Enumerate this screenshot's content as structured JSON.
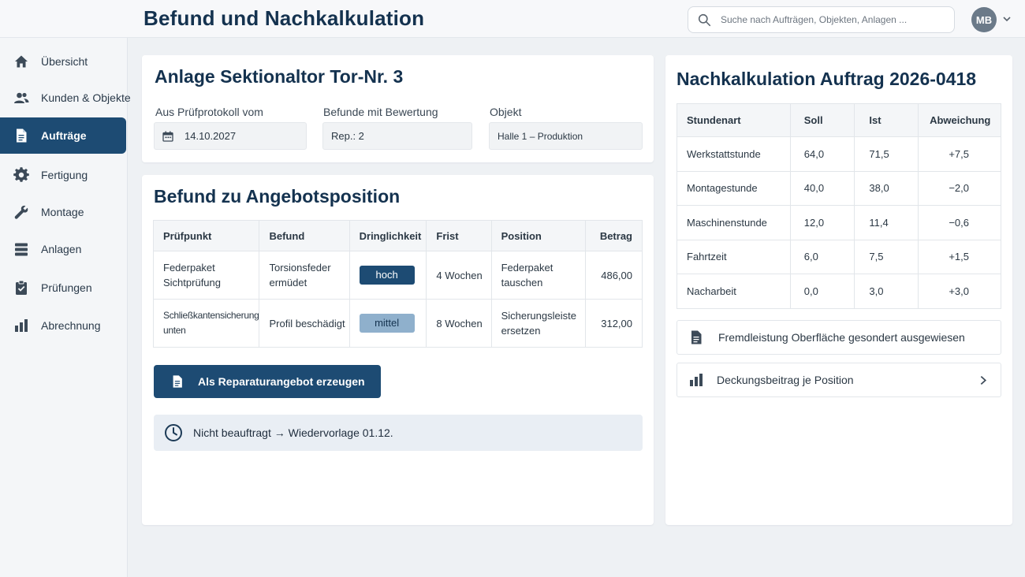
{
  "header": {
    "title": "Befund und Nachkalkulation",
    "search_placeholder": "Suche nach Aufträgen, Objekten, Anlagen ...",
    "avatar_initials": "MB"
  },
  "sidebar": {
    "items": [
      {
        "label": "Übersicht",
        "icon": "home-icon"
      },
      {
        "label": "Kunden & Objekte",
        "icon": "users-icon"
      },
      {
        "label": "Aufträge",
        "icon": "document-icon",
        "active": true
      },
      {
        "label": "Fertigung",
        "icon": "gear-icon"
      },
      {
        "label": "Montage",
        "icon": "wrench-icon"
      },
      {
        "label": "Anlagen",
        "icon": "layers-icon"
      },
      {
        "label": "Prüfungen",
        "icon": "clipboard-check-icon"
      },
      {
        "label": "Abrechnung",
        "icon": "bar-chart-icon"
      }
    ]
  },
  "anlage": {
    "title": "Anlage Sektionaltor Tor-Nr. 3",
    "fields": [
      {
        "label": "Aus Prüfprotokoll vom",
        "value": "14.10.2027"
      },
      {
        "label": "Befunde mit Bewertung",
        "value": "Rep.: 2"
      },
      {
        "label": "Objekt",
        "value": "Halle 1 – Produktion"
      }
    ]
  },
  "befund": {
    "title": "Befund zu Angebotsposition",
    "columns": [
      "Prüfpunkt",
      "Befund",
      "Dringlichkeit",
      "Frist",
      "Position",
      "Betrag"
    ],
    "rows": [
      {
        "pruefpunkt": "Federpaket Sichtprüfung",
        "befund": "Torsionsfeder ermüdet",
        "dringlichkeit": "hoch",
        "frist": "4 Wochen",
        "position": "Federpaket tauschen",
        "betrag": "486,00"
      },
      {
        "pruefpunkt": "Schließkantensicherung unten",
        "befund": "Profil beschädigt",
        "dringlichkeit": "mittel",
        "frist": "8 Wochen",
        "position": "Sicherungsleiste ersetzen",
        "betrag": "312,00"
      }
    ],
    "button_label": "Als Reparaturangebot erzeugen",
    "notice": "Nicht beauftragt → Wiedervorlage 01.12.",
    "colors": {
      "hoch": "#1d4b73",
      "mittel": "#8fb0cc"
    }
  },
  "nachkalkulation": {
    "title": "Nachkalkulation Auftrag 2026-0418",
    "columns": [
      "Stundenart",
      "Soll",
      "Ist",
      "Abweichung"
    ],
    "rows": [
      {
        "art": "Werkstattstunde",
        "soll": "64,0",
        "ist": "71,5",
        "abw": "+7,5"
      },
      {
        "art": "Montagestunde",
        "soll": "40,0",
        "ist": "38,0",
        "abw": "−2,0"
      },
      {
        "art": "Maschinenstunde",
        "soll": "12,0",
        "ist": "11,4",
        "abw": "−0,6"
      },
      {
        "art": "Fahrtzeit",
        "soll": "6,0",
        "ist": "7,5",
        "abw": "+1,5"
      },
      {
        "art": "Nacharbeit",
        "soll": "0,0",
        "ist": "3,0",
        "abw": "+3,0"
      }
    ],
    "fremdleistung": "Fremdleistung Oberfläche gesondert ausgewiesen",
    "deckungsbeitrag": "Deckungsbeitrag je Position"
  }
}
